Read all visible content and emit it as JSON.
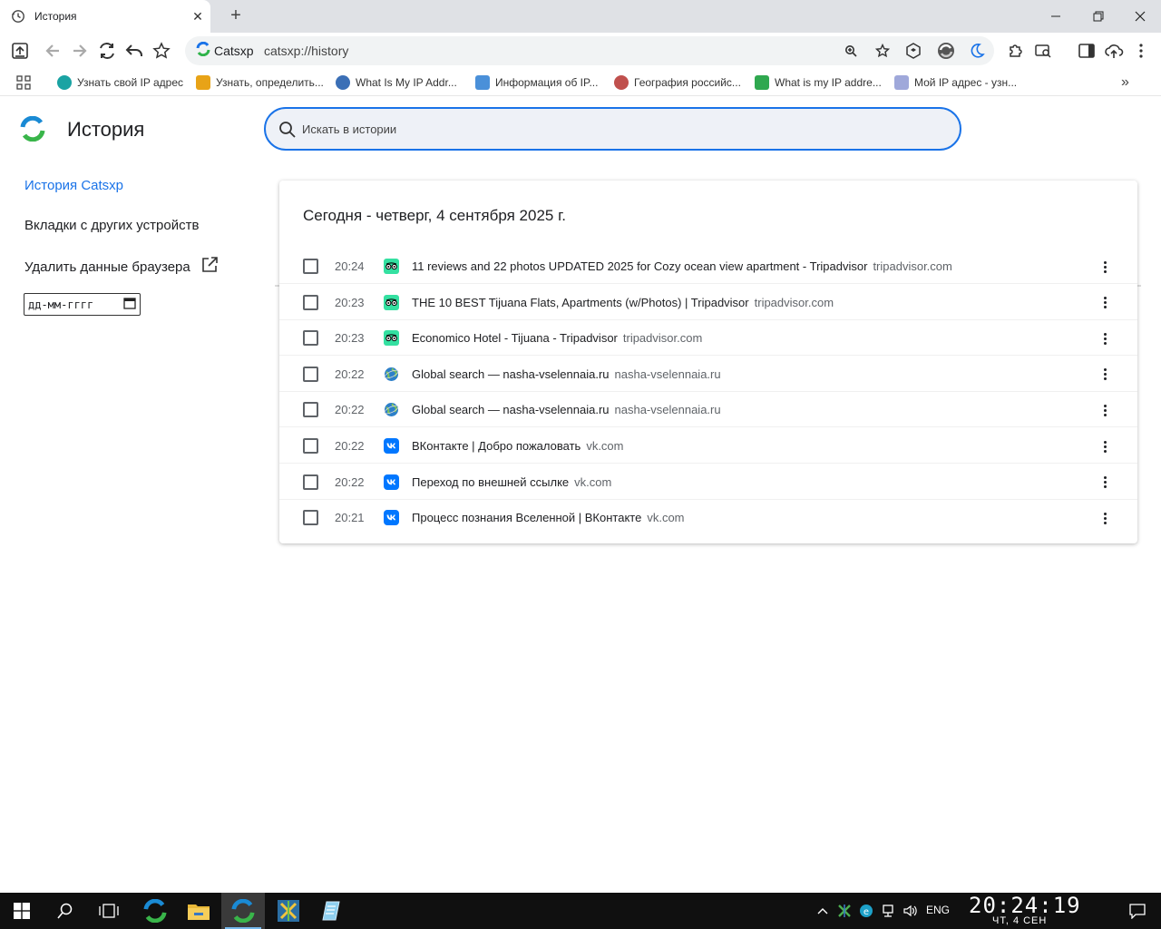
{
  "browser": {
    "tab_title": "История",
    "site_chip": "Catsxp",
    "url": "catsxp://history"
  },
  "bookmarks": [
    {
      "label": "Узнать свой IP адрес",
      "color": "#1aa3a3"
    },
    {
      "label": "Узнать, определить...",
      "color": "#e8a317"
    },
    {
      "label": "What Is My IP Addr...",
      "color": "#3b6fb6"
    },
    {
      "label": "Информация об IP...",
      "color": "#4a90d9"
    },
    {
      "label": "География российс...",
      "color": "#c0504d"
    },
    {
      "label": "What is my IP addre...",
      "color": "#2fa84f"
    },
    {
      "label": "Мой IP адрес - узн...",
      "color": "#9fa8da"
    }
  ],
  "page": {
    "title": "История",
    "search_placeholder": "Искать в истории"
  },
  "sidebar": {
    "items": [
      {
        "label": "История Catsxp"
      },
      {
        "label": "Вкладки с других устройств"
      },
      {
        "label": "Удалить данные браузера"
      }
    ],
    "date_placeholder": "дд-мм-гггг"
  },
  "history": {
    "heading": "Сегодня - четверг, 4 сентября 2025 г.",
    "entries": [
      {
        "time": "20:24",
        "title": "11 reviews and 22 photos UPDATED 2025 for Cozy ocean view apartment - Tripadvisor",
        "domain": "tripadvisor.com",
        "icon": "tripadvisor-icon"
      },
      {
        "time": "20:23",
        "title": "THE 10 BEST Tijuana Flats, Apartments (w/Photos) | Tripadvisor",
        "domain": "tripadvisor.com",
        "icon": "tripadvisor-icon"
      },
      {
        "time": "20:23",
        "title": "Economico Hotel - Tijuana - Tripadvisor",
        "domain": "tripadvisor.com",
        "icon": "tripadvisor-icon"
      },
      {
        "time": "20:22",
        "title": "Global search — nasha-vselennaia.ru",
        "domain": "nasha-vselennaia.ru",
        "icon": "globe-icon"
      },
      {
        "time": "20:22",
        "title": "Global search — nasha-vselennaia.ru",
        "domain": "nasha-vselennaia.ru",
        "icon": "globe-icon"
      },
      {
        "time": "20:22",
        "title": "ВКонтакте | Добро пожаловать",
        "domain": "vk.com",
        "icon": "vk-icon"
      },
      {
        "time": "20:22",
        "title": "Переход по внешней ссылке",
        "domain": "vk.com",
        "icon": "vk-icon"
      },
      {
        "time": "20:21",
        "title": "Процесс познания Вселенной | ВКонтакте",
        "domain": "vk.com",
        "icon": "vk-icon"
      }
    ]
  },
  "taskbar": {
    "lang": "ENG",
    "time": "20:24:19",
    "date": "ЧТ, 4 СЕН"
  },
  "colors": {
    "accent": "#1a73e8",
    "tripadvisor": "#34e0a1",
    "vk": "#0077ff"
  }
}
